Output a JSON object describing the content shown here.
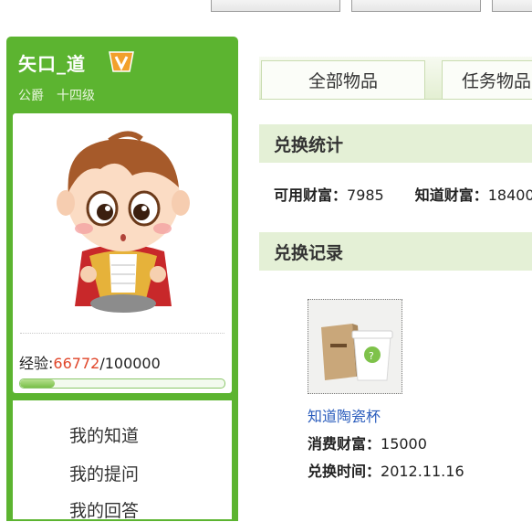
{
  "user": {
    "name": "矢口_道",
    "title": "公爵",
    "level": "十四级",
    "vip_icon": "vip-badge-icon"
  },
  "experience": {
    "label": "经验:",
    "current": "66772",
    "separator": "/",
    "max": "100000",
    "progress_fraction": 0.17
  },
  "nav": {
    "items": [
      {
        "label": "我的知道"
      },
      {
        "label": "我的提问"
      },
      {
        "label": "我的回答"
      }
    ]
  },
  "tabs": [
    {
      "label": "全部物品"
    },
    {
      "label": "任务物品"
    }
  ],
  "stats_section": {
    "title": "兑换统计",
    "available_label": "可用财富：",
    "available_value": "7985",
    "zhidao_label": "知道财富：",
    "zhidao_value": "18400"
  },
  "records_section": {
    "title": "兑换记录"
  },
  "record": {
    "name": "知道陶瓷杯",
    "cost_label": "消费财富：",
    "cost_value": "15000",
    "time_label": "兑换时间：",
    "time_value": "2012.11.16"
  },
  "colors": {
    "panel_green": "#5cb430",
    "section_bg": "#e4f0d6",
    "exp_current": "#e0462a",
    "link_blue": "#2b5dbd"
  }
}
